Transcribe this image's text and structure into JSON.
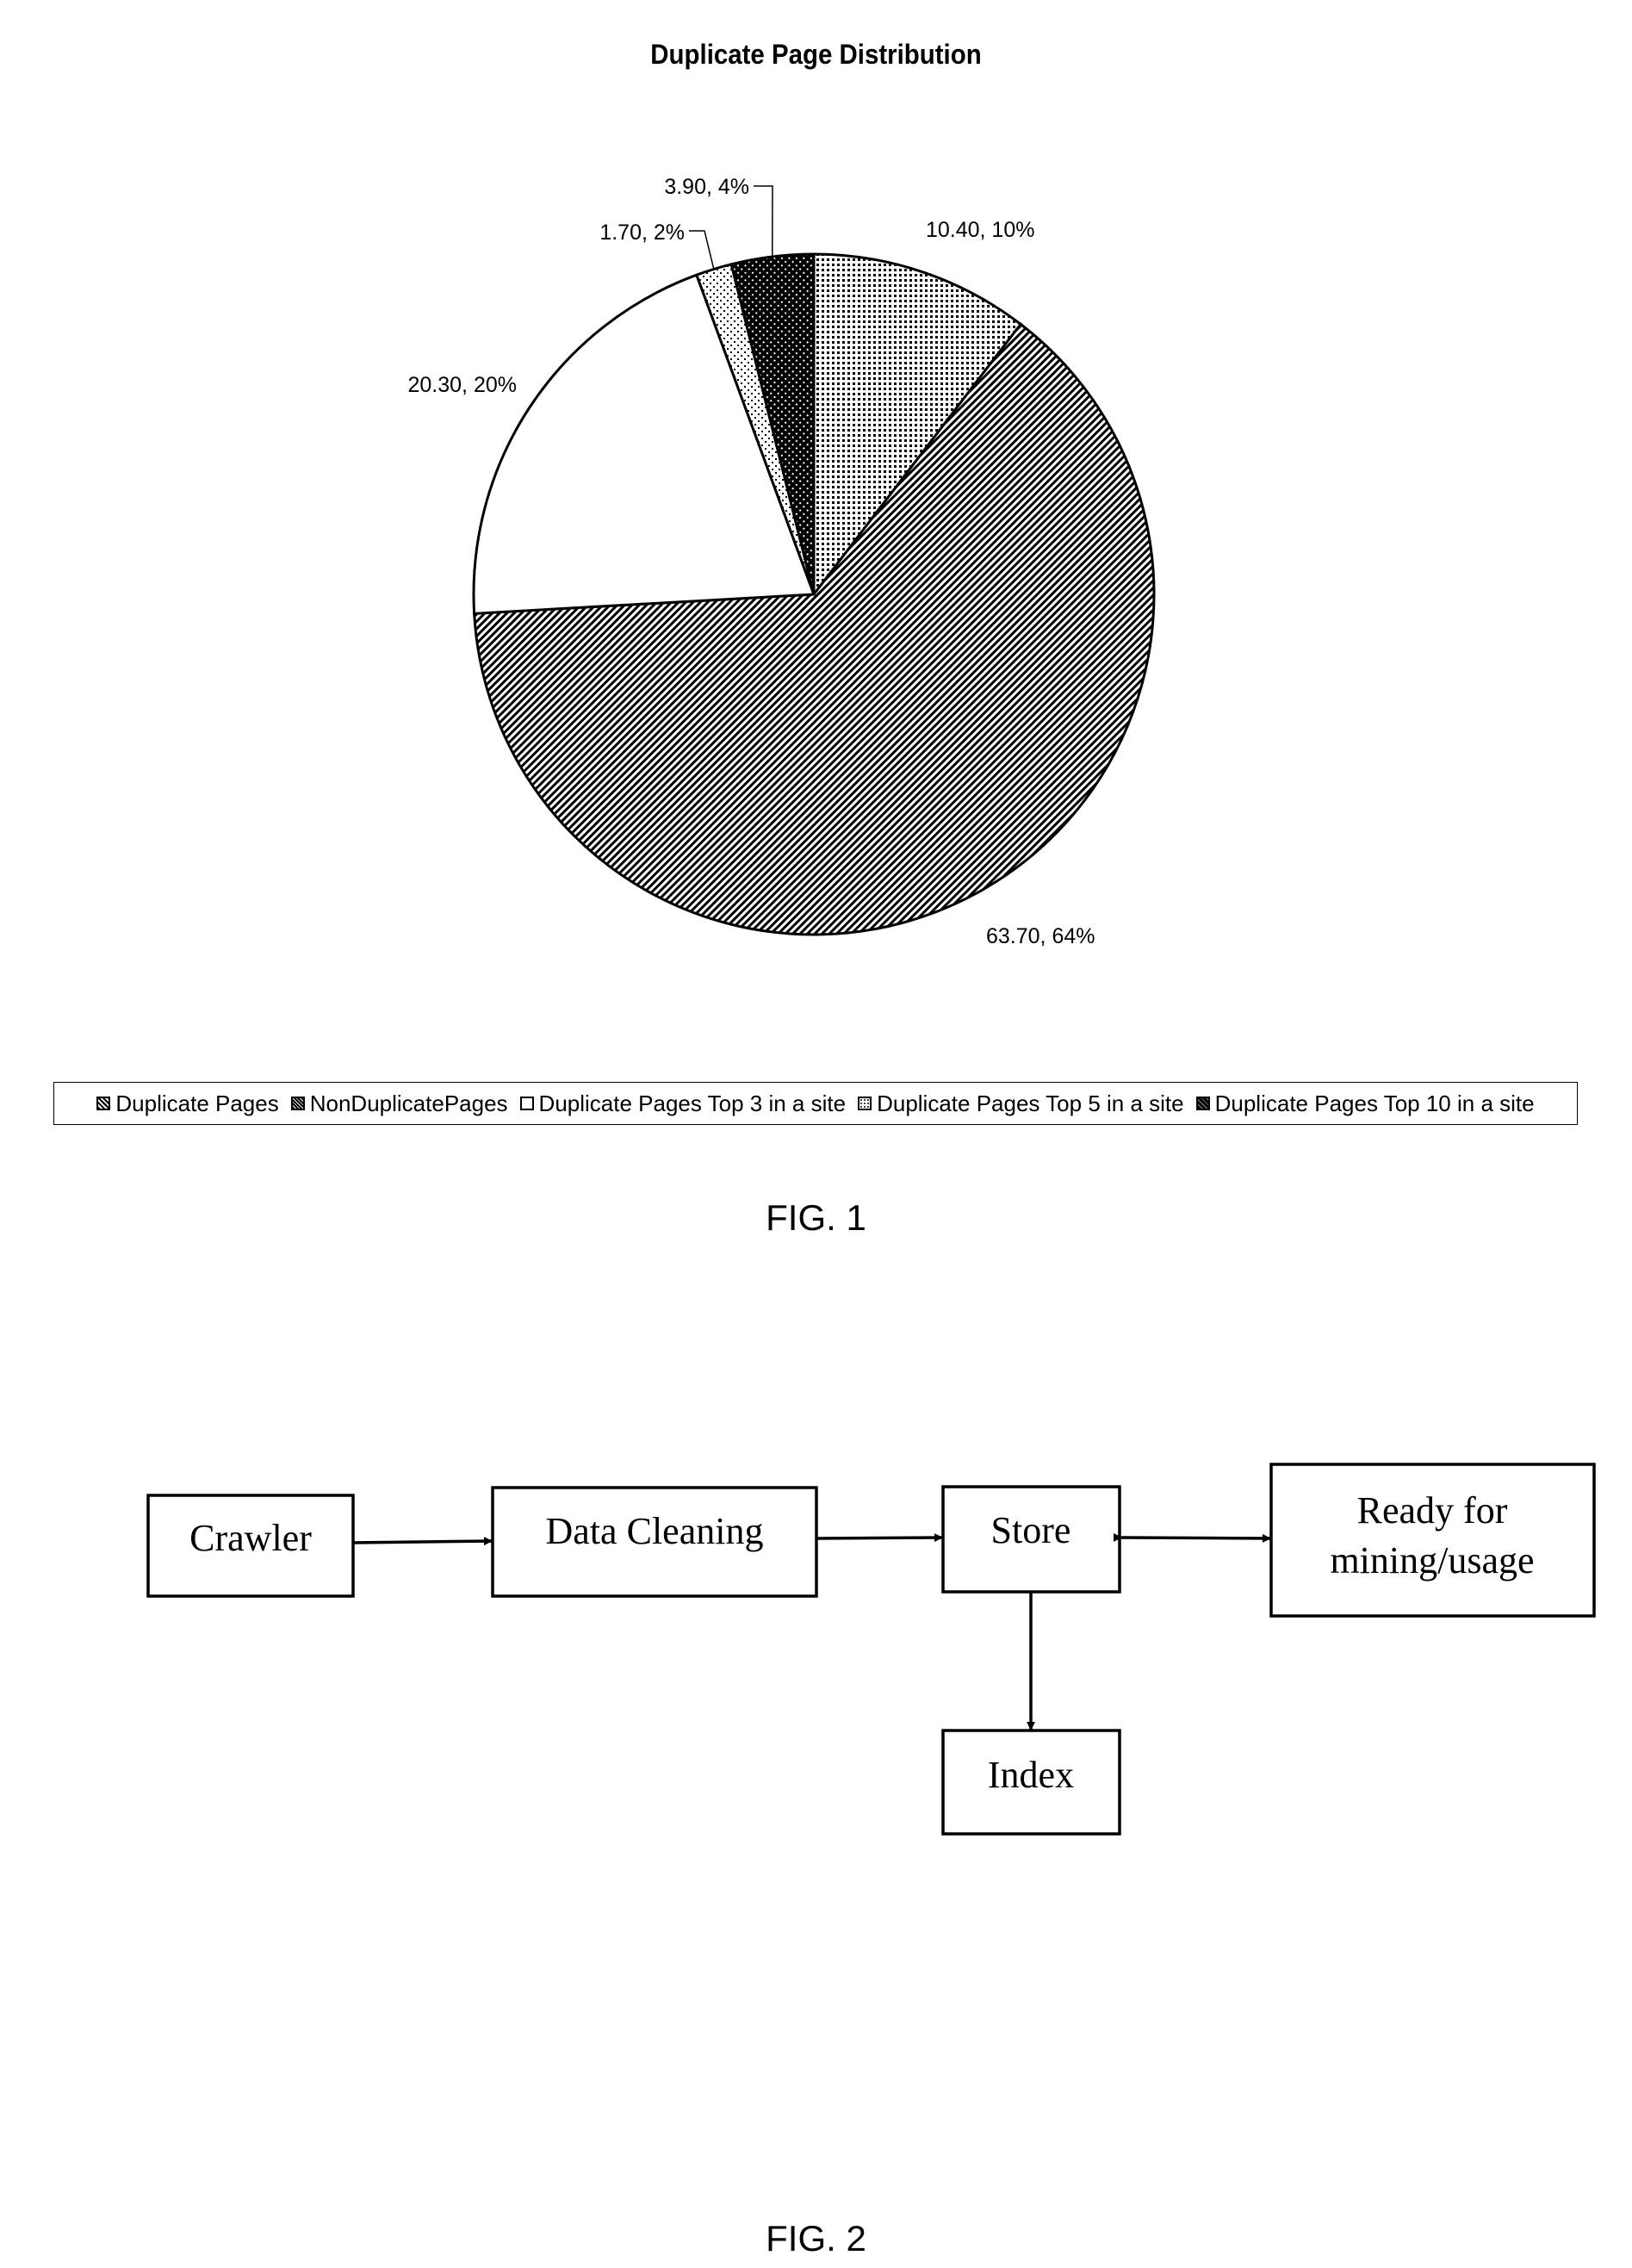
{
  "figure1": {
    "caption": "FIG. 1",
    "chart_data": {
      "type": "pie",
      "title": "Duplicate Page Distribution",
      "categories": [
        "Duplicate Pages",
        "NonDuplicatePages",
        "Duplicate Pages Top 3 in a site",
        "Duplicate Pages Top 5 in a site",
        "Duplicate Pages Top 10 in a site"
      ],
      "values": [
        10.4,
        63.7,
        20.3,
        1.7,
        3.9
      ],
      "percentages": [
        10,
        64,
        20,
        2,
        4
      ],
      "data_labels": [
        "10.40, 10%",
        "63.70, 64%",
        "20.30, 20%",
        "1.70, 2%",
        "3.90, 4%"
      ],
      "fill_patterns": [
        "fine-dots",
        "diagonal-hatch",
        "solid-white",
        "sparse-dots",
        "dark-checker"
      ],
      "start_angle": "12 o'clock",
      "direction": "clockwise",
      "legend_placement": "bottom",
      "xlabel": "",
      "ylabel": ""
    }
  },
  "figure2": {
    "caption": "FIG. 2",
    "nodes": [
      {
        "id": "crawler",
        "label": [
          "Crawler"
        ]
      },
      {
        "id": "cleaning",
        "label": [
          "Data Cleaning"
        ]
      },
      {
        "id": "store",
        "label": [
          "Store"
        ]
      },
      {
        "id": "ready",
        "label": [
          "Ready for",
          "mining/usage"
        ]
      },
      {
        "id": "index",
        "label": [
          "Index"
        ]
      }
    ],
    "edges": [
      {
        "from": "crawler",
        "to": "cleaning",
        "type": "one-way"
      },
      {
        "from": "cleaning",
        "to": "store",
        "type": "one-way"
      },
      {
        "from": "store",
        "to": "ready",
        "type": "two-way"
      },
      {
        "from": "store",
        "to": "index",
        "type": "one-way"
      }
    ]
  }
}
